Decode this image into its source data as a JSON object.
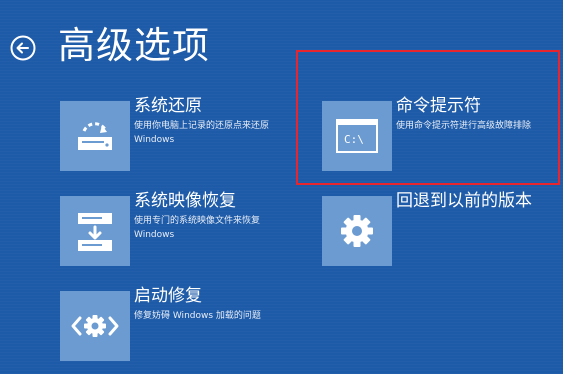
{
  "header": {
    "title": "高级选项",
    "back_icon": "back-arrow-circle-icon"
  },
  "tiles": [
    {
      "title": "系统还原",
      "desc_line1": "使用你电脑上记录的还原点来还原",
      "desc_line2": "Windows",
      "icon": "system-restore-icon"
    },
    {
      "title": "系统映像恢复",
      "desc_line1": "使用专门的系统映像文件来恢复",
      "desc_line2": "Windows",
      "icon": "system-image-recovery-icon"
    },
    {
      "title": "启动修复",
      "desc_line1": "修复妨碍 Windows 加载的问题",
      "icon": "startup-repair-icon"
    },
    {
      "title": "命令提示符",
      "desc_line1": "使用命令提示符进行高级故障排除",
      "icon": "command-prompt-icon",
      "icon_text": "C:\\"
    },
    {
      "title": "回退到以前的版本",
      "icon": "gear-icon"
    }
  ],
  "colors": {
    "background": "#1d5aa7",
    "tile_icon_bg": "#6b9bd1",
    "highlight": "#e8242c"
  }
}
